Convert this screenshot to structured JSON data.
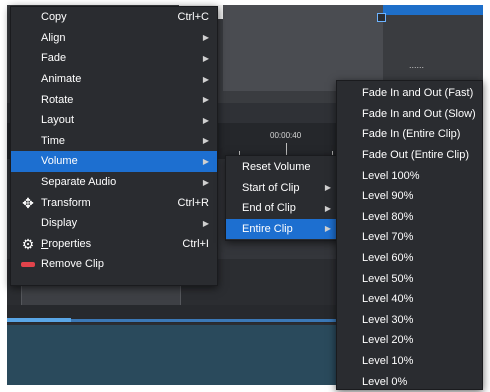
{
  "timeline": {
    "time_label": "00:00:40",
    "dots": "......"
  },
  "context_menu": {
    "items": [
      {
        "label": "Copy",
        "shortcut": "Ctrl+C"
      },
      {
        "label": "Align",
        "arrow": "▶"
      },
      {
        "label": "Fade",
        "arrow": "▶"
      },
      {
        "label": "Animate",
        "arrow": "▶"
      },
      {
        "label": "Rotate",
        "arrow": "▶"
      },
      {
        "label": "Layout",
        "arrow": "▶"
      },
      {
        "label": "Time",
        "arrow": "▶"
      },
      {
        "label": "Volume",
        "arrow": "▶",
        "selected": true
      },
      {
        "label": "Separate Audio",
        "arrow": "▶"
      },
      {
        "label": "Transform",
        "shortcut": "Ctrl+R",
        "icon": "move-icon"
      },
      {
        "label": "Display",
        "arrow": "▶"
      },
      {
        "label_rest": "roperties",
        "label_mnemonic": "P",
        "shortcut": "Ctrl+I",
        "icon": "gear-icon"
      },
      {
        "label": "Remove Clip",
        "icon": "remove-icon"
      }
    ]
  },
  "volume_submenu": {
    "items": [
      {
        "label": "Reset Volume"
      },
      {
        "label": "Start of Clip",
        "arrow": "▶"
      },
      {
        "label": "End of Clip",
        "arrow": "▶"
      },
      {
        "label": "Entire Clip",
        "arrow": "▶",
        "selected": true
      }
    ]
  },
  "entire_clip_submenu": {
    "items": [
      {
        "label": "Fade In and Out (Fast)"
      },
      {
        "label": "Fade In and Out (Slow)"
      },
      {
        "label": "Fade In (Entire Clip)"
      },
      {
        "label": "Fade Out (Entire Clip)"
      },
      {
        "label": "Level 100%"
      },
      {
        "label": "Level 90%"
      },
      {
        "label": "Level 80%"
      },
      {
        "label": "Level 70%"
      },
      {
        "label": "Level 60%"
      },
      {
        "label": "Level 50%"
      },
      {
        "label": "Level 40%"
      },
      {
        "label": "Level 30%"
      },
      {
        "label": "Level 20%"
      },
      {
        "label": "Level 10%"
      },
      {
        "label": "Level 0%"
      }
    ]
  },
  "colors": {
    "menu_bg": "#2a2c30",
    "selected": "#1d6fd0",
    "remove_icon": "#e2434b"
  }
}
